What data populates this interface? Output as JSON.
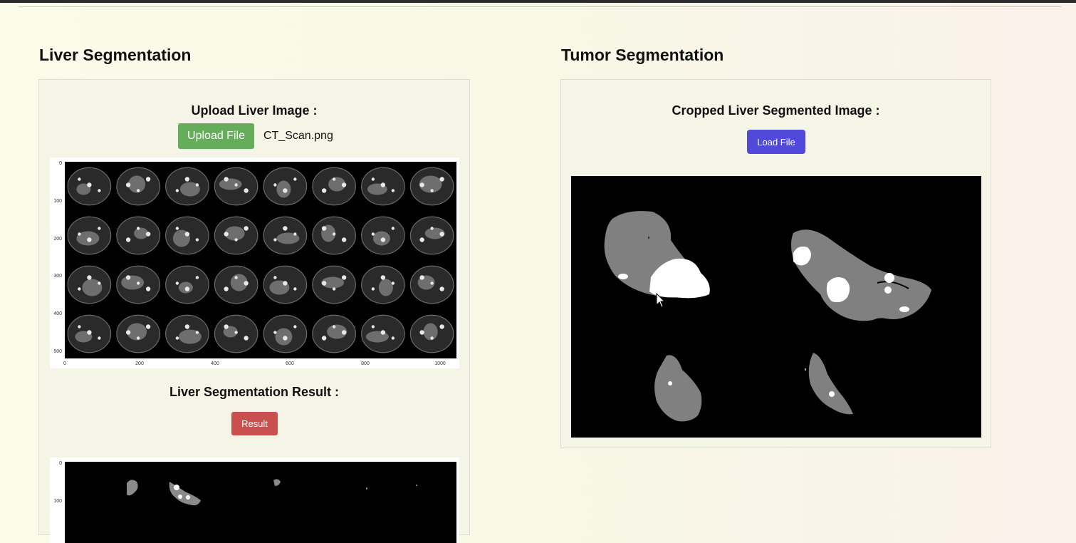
{
  "liver": {
    "title": "Liver Segmentation",
    "upload_heading": "Upload Liver Image :",
    "upload_button": "Upload File",
    "filename": "CT_Scan.png",
    "ct_plot": {
      "y_ticks": [
        "0",
        "100",
        "200",
        "300",
        "400",
        "500"
      ],
      "x_ticks": [
        "0",
        "200",
        "400",
        "600",
        "800",
        "1000"
      ]
    },
    "result_heading": "Liver Segmentation Result :",
    "result_button": "Result",
    "result_plot": {
      "y_ticks": [
        "0",
        "100"
      ]
    }
  },
  "tumor": {
    "title": "Tumor Segmentation",
    "cropped_heading": "Cropped Liver Segmented Image :",
    "load_button": "Load File"
  },
  "colors": {
    "upload_button": "#66ad5b",
    "load_button": "#5149d9",
    "result_button": "#c9504e"
  },
  "icons": [
    "cursor-arrow-icon"
  ]
}
